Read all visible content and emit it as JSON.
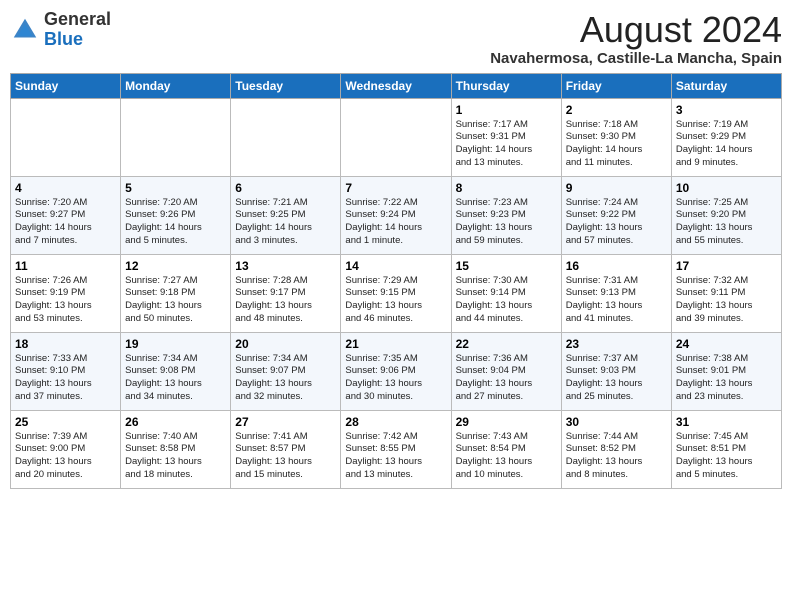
{
  "header": {
    "logo_general": "General",
    "logo_blue": "Blue",
    "month_title": "August 2024",
    "location": "Navahermosa, Castille-La Mancha, Spain"
  },
  "days_of_week": [
    "Sunday",
    "Monday",
    "Tuesday",
    "Wednesday",
    "Thursday",
    "Friday",
    "Saturday"
  ],
  "weeks": [
    [
      {
        "day": "",
        "info": ""
      },
      {
        "day": "",
        "info": ""
      },
      {
        "day": "",
        "info": ""
      },
      {
        "day": "",
        "info": ""
      },
      {
        "day": "1",
        "info": "Sunrise: 7:17 AM\nSunset: 9:31 PM\nDaylight: 14 hours\nand 13 minutes."
      },
      {
        "day": "2",
        "info": "Sunrise: 7:18 AM\nSunset: 9:30 PM\nDaylight: 14 hours\nand 11 minutes."
      },
      {
        "day": "3",
        "info": "Sunrise: 7:19 AM\nSunset: 9:29 PM\nDaylight: 14 hours\nand 9 minutes."
      }
    ],
    [
      {
        "day": "4",
        "info": "Sunrise: 7:20 AM\nSunset: 9:27 PM\nDaylight: 14 hours\nand 7 minutes."
      },
      {
        "day": "5",
        "info": "Sunrise: 7:20 AM\nSunset: 9:26 PM\nDaylight: 14 hours\nand 5 minutes."
      },
      {
        "day": "6",
        "info": "Sunrise: 7:21 AM\nSunset: 9:25 PM\nDaylight: 14 hours\nand 3 minutes."
      },
      {
        "day": "7",
        "info": "Sunrise: 7:22 AM\nSunset: 9:24 PM\nDaylight: 14 hours\nand 1 minute."
      },
      {
        "day": "8",
        "info": "Sunrise: 7:23 AM\nSunset: 9:23 PM\nDaylight: 13 hours\nand 59 minutes."
      },
      {
        "day": "9",
        "info": "Sunrise: 7:24 AM\nSunset: 9:22 PM\nDaylight: 13 hours\nand 57 minutes."
      },
      {
        "day": "10",
        "info": "Sunrise: 7:25 AM\nSunset: 9:20 PM\nDaylight: 13 hours\nand 55 minutes."
      }
    ],
    [
      {
        "day": "11",
        "info": "Sunrise: 7:26 AM\nSunset: 9:19 PM\nDaylight: 13 hours\nand 53 minutes."
      },
      {
        "day": "12",
        "info": "Sunrise: 7:27 AM\nSunset: 9:18 PM\nDaylight: 13 hours\nand 50 minutes."
      },
      {
        "day": "13",
        "info": "Sunrise: 7:28 AM\nSunset: 9:17 PM\nDaylight: 13 hours\nand 48 minutes."
      },
      {
        "day": "14",
        "info": "Sunrise: 7:29 AM\nSunset: 9:15 PM\nDaylight: 13 hours\nand 46 minutes."
      },
      {
        "day": "15",
        "info": "Sunrise: 7:30 AM\nSunset: 9:14 PM\nDaylight: 13 hours\nand 44 minutes."
      },
      {
        "day": "16",
        "info": "Sunrise: 7:31 AM\nSunset: 9:13 PM\nDaylight: 13 hours\nand 41 minutes."
      },
      {
        "day": "17",
        "info": "Sunrise: 7:32 AM\nSunset: 9:11 PM\nDaylight: 13 hours\nand 39 minutes."
      }
    ],
    [
      {
        "day": "18",
        "info": "Sunrise: 7:33 AM\nSunset: 9:10 PM\nDaylight: 13 hours\nand 37 minutes."
      },
      {
        "day": "19",
        "info": "Sunrise: 7:34 AM\nSunset: 9:08 PM\nDaylight: 13 hours\nand 34 minutes."
      },
      {
        "day": "20",
        "info": "Sunrise: 7:34 AM\nSunset: 9:07 PM\nDaylight: 13 hours\nand 32 minutes."
      },
      {
        "day": "21",
        "info": "Sunrise: 7:35 AM\nSunset: 9:06 PM\nDaylight: 13 hours\nand 30 minutes."
      },
      {
        "day": "22",
        "info": "Sunrise: 7:36 AM\nSunset: 9:04 PM\nDaylight: 13 hours\nand 27 minutes."
      },
      {
        "day": "23",
        "info": "Sunrise: 7:37 AM\nSunset: 9:03 PM\nDaylight: 13 hours\nand 25 minutes."
      },
      {
        "day": "24",
        "info": "Sunrise: 7:38 AM\nSunset: 9:01 PM\nDaylight: 13 hours\nand 23 minutes."
      }
    ],
    [
      {
        "day": "25",
        "info": "Sunrise: 7:39 AM\nSunset: 9:00 PM\nDaylight: 13 hours\nand 20 minutes."
      },
      {
        "day": "26",
        "info": "Sunrise: 7:40 AM\nSunset: 8:58 PM\nDaylight: 13 hours\nand 18 minutes."
      },
      {
        "day": "27",
        "info": "Sunrise: 7:41 AM\nSunset: 8:57 PM\nDaylight: 13 hours\nand 15 minutes."
      },
      {
        "day": "28",
        "info": "Sunrise: 7:42 AM\nSunset: 8:55 PM\nDaylight: 13 hours\nand 13 minutes."
      },
      {
        "day": "29",
        "info": "Sunrise: 7:43 AM\nSunset: 8:54 PM\nDaylight: 13 hours\nand 10 minutes."
      },
      {
        "day": "30",
        "info": "Sunrise: 7:44 AM\nSunset: 8:52 PM\nDaylight: 13 hours\nand 8 minutes."
      },
      {
        "day": "31",
        "info": "Sunrise: 7:45 AM\nSunset: 8:51 PM\nDaylight: 13 hours\nand 5 minutes."
      }
    ]
  ]
}
